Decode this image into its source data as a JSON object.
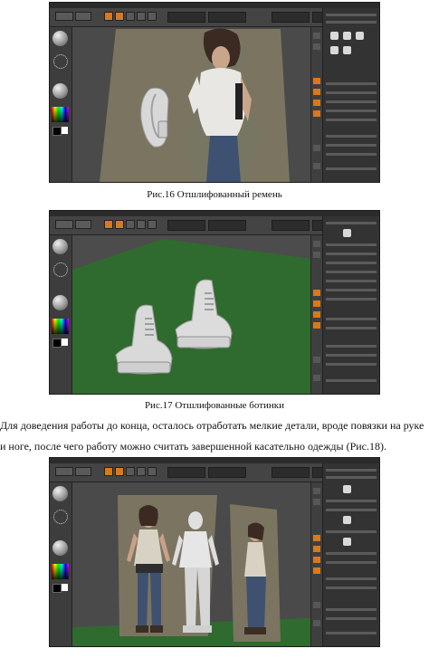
{
  "figures": [
    {
      "caption": "Рис.16 Отшлифованный ремень",
      "app": "ZBrush",
      "subject": "сглаженный поясной ремень рядом с фигурой девушки"
    },
    {
      "caption": "Рис.17 Отшлифованные ботинки",
      "app": "ZBrush",
      "subject": "пара ботинок на зелёной плоскости"
    },
    {
      "caption": "",
      "app": "ZBrush",
      "subject": "три вида персонажа перед опорными изображениями"
    }
  ],
  "paragraph": {
    "line1": "Для доведения работы до конца, осталось отработать мелкие детали, вроде повязки на руке",
    "line2": "и ноге, после чего работу можно считать завершенной касательно одежды (Рис.18)."
  },
  "colors": {
    "ui_bg": "#3a3a3a",
    "accent": "#d6791f",
    "grass": "#2f6b2e",
    "reference_bg": "#7b7460"
  }
}
